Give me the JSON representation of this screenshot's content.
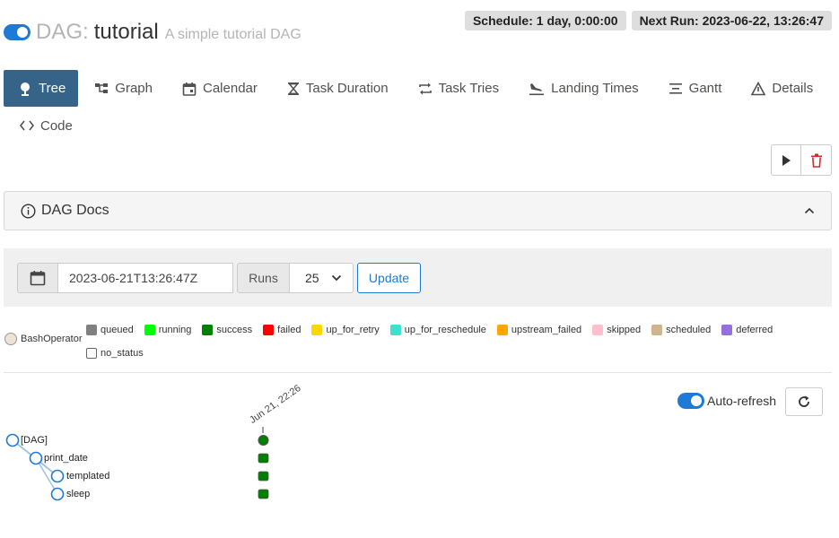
{
  "header": {
    "dag_prefix": "DAG:",
    "dag_name": "tutorial",
    "description": "A simple tutorial DAG",
    "schedule": "Schedule: 1 day, 0:00:00",
    "next_run": "Next Run: 2023-06-22, 13:26:47"
  },
  "nav": {
    "tabs": [
      {
        "label": "Tree",
        "icon": "tree-icon"
      },
      {
        "label": "Graph",
        "icon": "graph-icon"
      },
      {
        "label": "Calendar",
        "icon": "calendar-icon"
      },
      {
        "label": "Task Duration",
        "icon": "hourglass-icon"
      },
      {
        "label": "Task Tries",
        "icon": "repeat-icon"
      },
      {
        "label": "Landing Times",
        "icon": "plane-landing-icon"
      },
      {
        "label": "Gantt",
        "icon": "gantt-icon"
      },
      {
        "label": "Details",
        "icon": "warning-triangle-icon"
      },
      {
        "label": "Code",
        "icon": "code-icon"
      }
    ]
  },
  "docs": {
    "title": "DAG Docs"
  },
  "form": {
    "date_value": "2023-06-21T13:26:47Z",
    "runs_label": "Runs",
    "runs_value": "25",
    "update_label": "Update"
  },
  "legend": {
    "operator": "BashOperator",
    "states": [
      {
        "label": "queued",
        "color": "#808080"
      },
      {
        "label": "running",
        "color": "#00ff00"
      },
      {
        "label": "success",
        "color": "#008000"
      },
      {
        "label": "failed",
        "color": "#ff0000"
      },
      {
        "label": "up_for_retry",
        "color": "#ffd700"
      },
      {
        "label": "up_for_reschedule",
        "color": "#40e0d0"
      },
      {
        "label": "upstream_failed",
        "color": "#ffa500"
      },
      {
        "label": "skipped",
        "color": "#ffc0cb"
      },
      {
        "label": "scheduled",
        "color": "#d2b48c"
      },
      {
        "label": "deferred",
        "color": "#9370db"
      },
      {
        "label": "no_status",
        "color": "#ffffff"
      }
    ]
  },
  "autorefresh": {
    "label": "Auto-refresh"
  },
  "tree": {
    "run_label": "Jun 21, 22:26",
    "nodes": [
      {
        "label": "[DAG]",
        "depth": 0
      },
      {
        "label": "print_date",
        "depth": 1
      },
      {
        "label": "templated",
        "depth": 2
      },
      {
        "label": "sleep",
        "depth": 2
      }
    ]
  },
  "colors": {
    "accent": "#1f7ad6",
    "active_tab": "#366488",
    "success": "#008000"
  }
}
